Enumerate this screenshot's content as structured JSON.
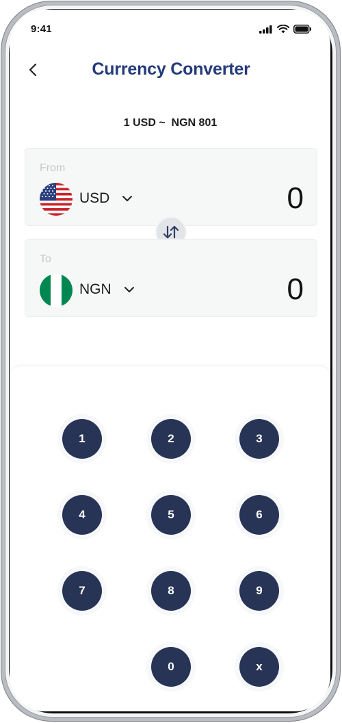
{
  "status_bar": {
    "time": "9:41"
  },
  "header": {
    "title": "Currency Converter"
  },
  "rate": {
    "text": "1 USD ~  NGN 801"
  },
  "from": {
    "label": "From",
    "currency": "USD",
    "amount": "0"
  },
  "to": {
    "label": "To",
    "currency": "NGN",
    "amount": "0"
  },
  "keypad": {
    "keys": [
      "1",
      "2",
      "3",
      "4",
      "5",
      "6",
      "7",
      "8",
      "9",
      "0",
      "x"
    ]
  },
  "colors": {
    "title": "#253a7a",
    "key_background": "#283456",
    "nigeria_green": "#008751"
  }
}
